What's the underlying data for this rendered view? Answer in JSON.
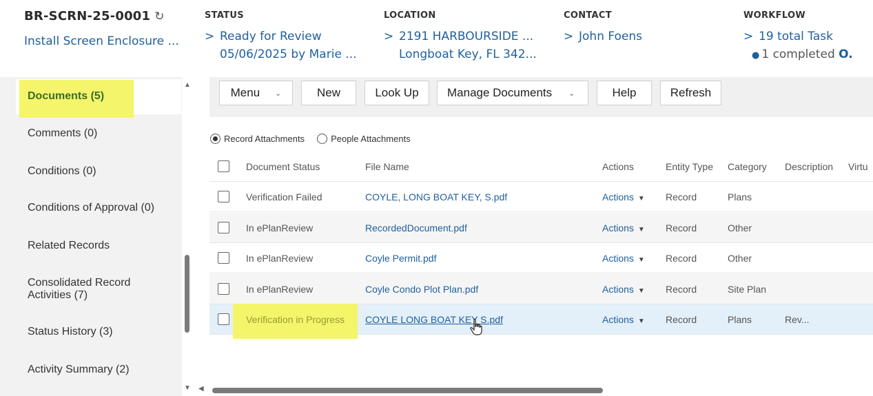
{
  "header": {
    "record_id": "BR-SCRN-25-0001",
    "record_name": "Install Screen Enclosure ...",
    "status": {
      "label": "STATUS",
      "line1": "Ready for Review",
      "line2": "05/06/2025 by Marie ..."
    },
    "location": {
      "label": "LOCATION",
      "line1": "2191 HARBOURSIDE ...",
      "line2": "Longboat Key, FL 342..."
    },
    "contact": {
      "label": "CONTACT",
      "line1": "John Foens"
    },
    "workflow": {
      "label": "WORKFLOW",
      "line1": "19 total Task",
      "line2": "1 completed",
      "line2_tail": "O."
    }
  },
  "sidebar": {
    "items": [
      {
        "label": "Documents (5)"
      },
      {
        "label": "Comments (0)"
      },
      {
        "label": "Conditions (0)"
      },
      {
        "label": "Conditions of Approval (0)"
      },
      {
        "label": "Related Records"
      },
      {
        "label": "Consolidated Record Activities (7)"
      },
      {
        "label": "Status History (3)"
      },
      {
        "label": "Activity Summary (2)"
      }
    ]
  },
  "toolbar": {
    "menu": "Menu",
    "new": "New",
    "lookup": "Look Up",
    "manage": "Manage Documents",
    "help": "Help",
    "refresh": "Refresh"
  },
  "attachments": {
    "record": "Record Attachments",
    "people": "People Attachments",
    "selected": "record"
  },
  "table": {
    "columns": [
      "Document Status",
      "File Name",
      "Actions",
      "Entity Type",
      "Category",
      "Description",
      "Virtu"
    ],
    "rows": [
      {
        "status": "Verification Failed",
        "file": "COYLE, LONG BOAT KEY, S.pdf",
        "actions": "Actions",
        "entity": "Record",
        "category": "Plans",
        "description": ""
      },
      {
        "status": "In ePlanReview",
        "file": "RecordedDocument.pdf",
        "actions": "Actions",
        "entity": "Record",
        "category": "Other",
        "description": ""
      },
      {
        "status": "In ePlanReview",
        "file": "Coyle Permit.pdf",
        "actions": "Actions",
        "entity": "Record",
        "category": "Other",
        "description": ""
      },
      {
        "status": "In ePlanReview",
        "file": "Coyle Condo Plot Plan.pdf",
        "actions": "Actions",
        "entity": "Record",
        "category": "Site Plan",
        "description": ""
      },
      {
        "status": "Verification in Progress",
        "file": "COYLE LONG BOAT KEY S.pdf",
        "actions": "Actions",
        "entity": "Record",
        "category": "Plans",
        "description": "Rev..."
      }
    ]
  },
  "colors": {
    "link": "#1f5f9e",
    "highlight": "#f4f56a",
    "selected_row": "#e3eff9"
  }
}
